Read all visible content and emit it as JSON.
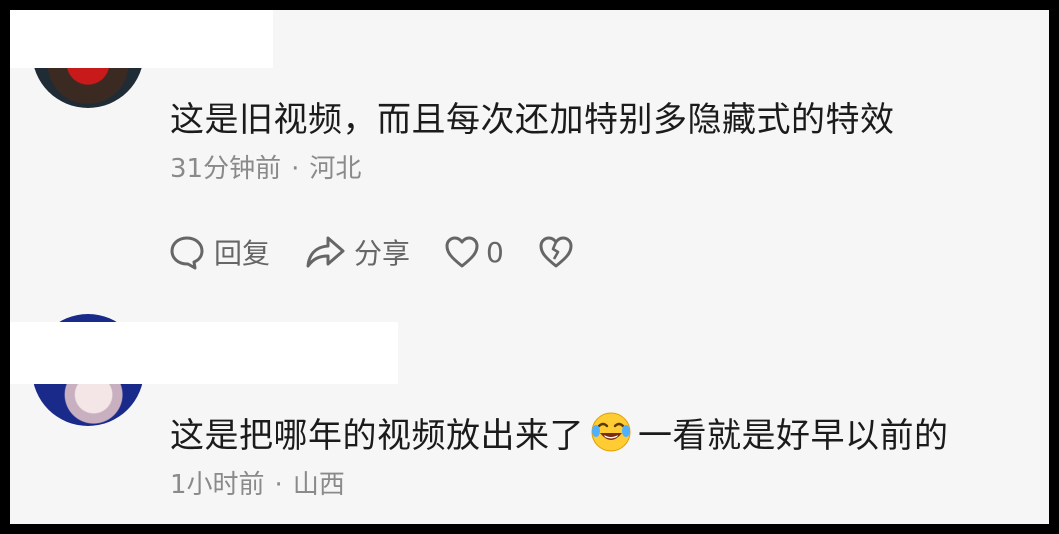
{
  "comments": [
    {
      "text": "这是旧视频，而且每次还加特别多隐藏式的特效",
      "time": "31分钟前",
      "separator": "·",
      "location": "河北",
      "actions": {
        "reply_label": "回复",
        "share_label": "分享",
        "like_count": "0"
      },
      "icons": [
        "reply-bubble-icon",
        "share-arrow-icon",
        "heart-icon",
        "broken-heart-icon"
      ]
    },
    {
      "text_before_emoji": "这是把哪年的视频放出来了",
      "emoji": "laugh-cry-emoji",
      "text_after_emoji": "一看就是好早以前的",
      "time": "1小时前",
      "separator": "·",
      "location": "山西"
    }
  ],
  "colors": {
    "background": "#f6f6f6",
    "text": "#1b1b1b",
    "meta": "#8a8a8a",
    "icon": "#666666"
  }
}
